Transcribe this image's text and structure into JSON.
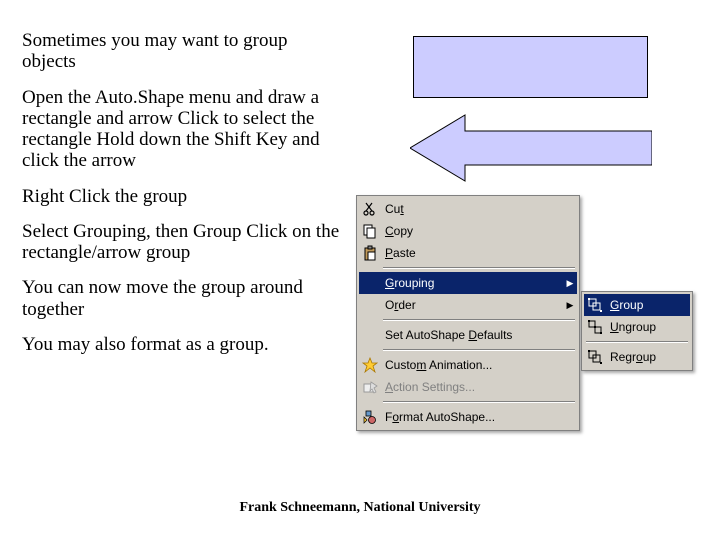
{
  "instructions": {
    "p1": "Sometimes you may want to group objects",
    "p2": "Open the Auto.Shape menu and draw a rectangle and arrow Click to select the rectangle Hold down the Shift Key and click the arrow",
    "p3": "Right Click the group",
    "p4": "Select Grouping, then Group Click on the rectangle/arrow group",
    "p5": "You can now move the group around together",
    "p6": "You may also format as a group."
  },
  "shapes": {
    "fill": "#ccccff",
    "stroke": "#000000"
  },
  "context_menu": {
    "items": [
      {
        "label": "Cut",
        "icon": "cut-icon",
        "key": "t"
      },
      {
        "label": "Copy",
        "icon": "copy-icon",
        "key": "C"
      },
      {
        "label": "Paste",
        "icon": "paste-icon",
        "key": "P"
      },
      {
        "label": "Grouping",
        "icon": "",
        "submenu": true,
        "highlight": true,
        "key": "G"
      },
      {
        "label": "Order",
        "icon": "",
        "submenu": true,
        "key": "R"
      },
      {
        "label": "Set AutoShape Defaults",
        "icon": "",
        "key": "D"
      },
      {
        "label": "Custom Animation...",
        "icon": "anim-icon",
        "key": "M"
      },
      {
        "label": "Action Settings...",
        "icon": "action-icon",
        "disabled": true,
        "key": "A"
      },
      {
        "label": "Format AutoShape...",
        "icon": "format-icon",
        "key": "O"
      }
    ]
  },
  "submenu": {
    "items": [
      {
        "label": "Group",
        "icon": "group-icon",
        "highlight": true,
        "key": "G"
      },
      {
        "label": "Ungroup",
        "icon": "ungroup-icon",
        "key": "U"
      },
      {
        "label": "Regroup",
        "icon": "regroup-icon",
        "key": "O"
      }
    ]
  },
  "footer": "Frank Schneemann, National University"
}
